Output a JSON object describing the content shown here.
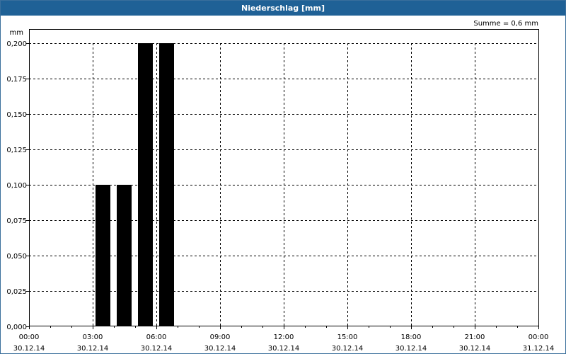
{
  "window": {
    "title": "Niederschlag [mm]"
  },
  "chart_data": {
    "type": "bar",
    "title": "Niederschlag [mm]",
    "ylabel": "mm",
    "summary": "Summe = 0,6 mm",
    "ylim": [
      0,
      0.2
    ],
    "y_ticks": [
      0,
      0.025,
      0.05,
      0.075,
      0.1,
      0.125,
      0.15,
      0.175,
      0.2
    ],
    "y_tick_labels": [
      "0,000",
      "0,025",
      "0,050",
      "0,075",
      "0,100",
      "0,125",
      "0,150",
      "0,175",
      "0,200"
    ],
    "x_range_hours": [
      0,
      24
    ],
    "x_ticks_hours": [
      0,
      3,
      6,
      9,
      12,
      15,
      18,
      21,
      24
    ],
    "x_tick_labels": [
      {
        "time": "00:00",
        "date": "30.12.14"
      },
      {
        "time": "03:00",
        "date": "30.12.14"
      },
      {
        "time": "06:00",
        "date": "30.12.14"
      },
      {
        "time": "09:00",
        "date": "30.12.14"
      },
      {
        "time": "12:00",
        "date": "30.12.14"
      },
      {
        "time": "15:00",
        "date": "30.12.14"
      },
      {
        "time": "18:00",
        "date": "30.12.14"
      },
      {
        "time": "21:00",
        "date": "30.12.14"
      },
      {
        "time": "00:00",
        "date": "31.12.14"
      }
    ],
    "series": [
      {
        "bars": [
          {
            "x": "30.12.14 03:00–04:00",
            "value": 0.1
          },
          {
            "x": "30.12.14 04:00–05:00",
            "value": 0.1
          },
          {
            "x": "30.12.14 05:00–06:00",
            "value": 0.2
          },
          {
            "x": "30.12.14 06:00–07:00",
            "value": 0.2
          }
        ]
      }
    ],
    "grid": true,
    "bar_color": "#000000"
  }
}
